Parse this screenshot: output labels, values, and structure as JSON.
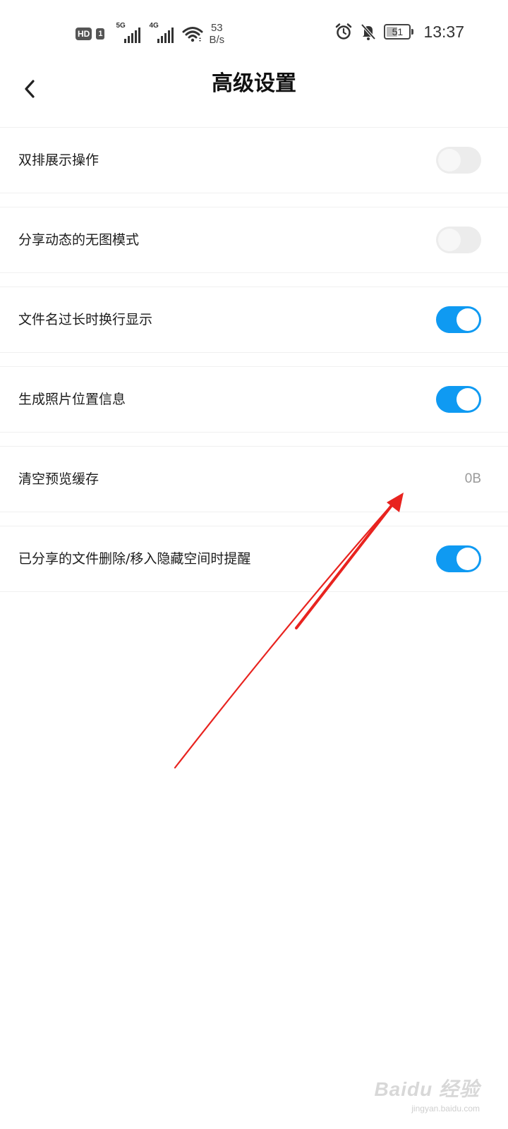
{
  "status_bar": {
    "hd_badge": "HD",
    "sim_badge": "1",
    "net1_label": "5G",
    "net2_label": "4G",
    "speed_value": "53",
    "speed_unit": "B/s",
    "battery_level": "51",
    "battery_fraction": 0.51,
    "time": "13:37",
    "icons": [
      "signal-5g-icon",
      "signal-4g-icon",
      "wifi-icon",
      "alarm-icon",
      "notifications-muted-icon",
      "battery-icon"
    ]
  },
  "header": {
    "back_icon": "chevron-left-icon",
    "title": "高级设置"
  },
  "settings": [
    {
      "label": "双排展示操作",
      "type": "toggle",
      "on": false
    },
    {
      "label": "分享动态的无图模式",
      "type": "toggle",
      "on": false
    },
    {
      "label": "文件名过长时换行显示",
      "type": "toggle",
      "on": true
    },
    {
      "label": "生成照片位置信息",
      "type": "toggle",
      "on": true
    },
    {
      "label": "清空预览缓存",
      "type": "value",
      "value": "0B"
    },
    {
      "label": "已分享的文件删除/移入隐藏空间时提醒",
      "type": "toggle",
      "on": true
    }
  ],
  "colors": {
    "toggle_on": "#0f9af2",
    "toggle_off": "#ececec",
    "annotation_arrow": "#e8231f"
  },
  "watermark": {
    "main": "Baidu 经验",
    "sub": "jingyan.baidu.com"
  }
}
